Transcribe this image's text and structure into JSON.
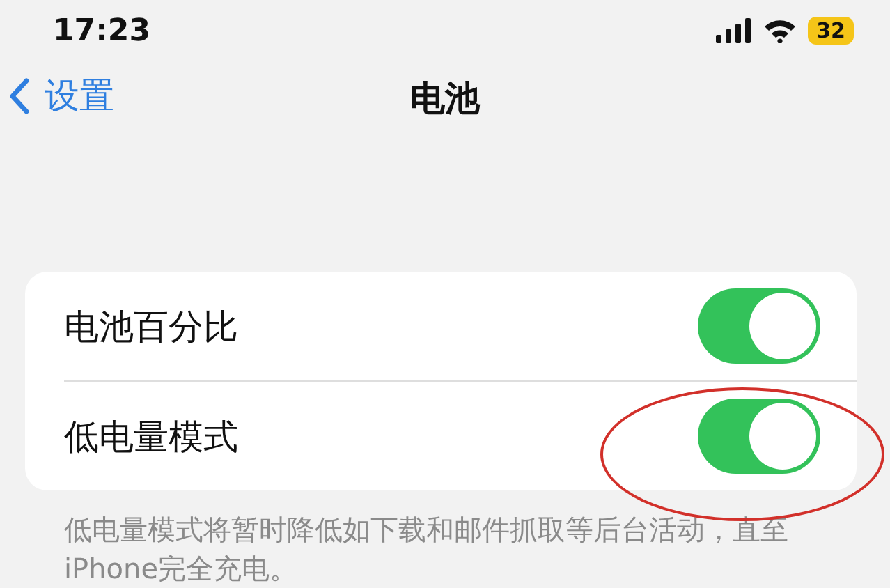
{
  "status_bar": {
    "time": "17:23",
    "battery": "32",
    "low_power": true
  },
  "nav": {
    "back": "设置",
    "title": "电池"
  },
  "rows": [
    {
      "label": "电池百分比",
      "on": true,
      "circled": false
    },
    {
      "label": "低电量模式",
      "on": true,
      "circled": true
    }
  ],
  "footnote": "低电量模式将暂时降低如下载和邮件抓取等后台活动，直至iPhone完全充电。"
}
